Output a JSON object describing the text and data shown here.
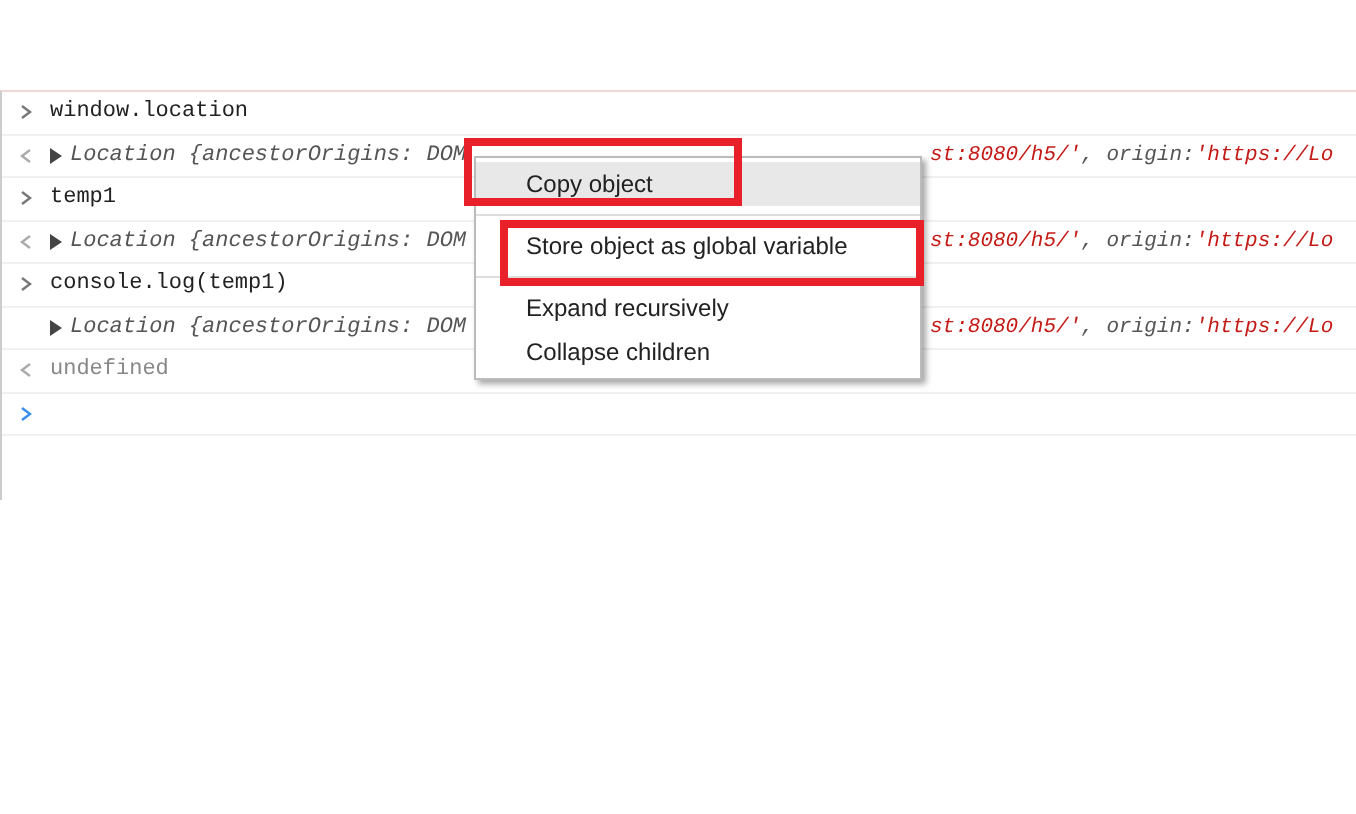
{
  "console": {
    "rows": [
      {
        "kind": "input",
        "text": "window.location"
      },
      {
        "kind": "result",
        "left": "Location {ancestorOrigins: DOM",
        "right": [
          {
            "kind": "string",
            "text": "st:8080/h5/'"
          },
          {
            "kind": "key",
            "text": ", origin: "
          },
          {
            "kind": "string",
            "text": "'https://Lo"
          }
        ]
      },
      {
        "kind": "input",
        "text": "temp1"
      },
      {
        "kind": "result",
        "left": "Location {ancestorOrigins: DOM",
        "right": [
          {
            "kind": "string",
            "text": "st:8080/h5/'"
          },
          {
            "kind": "key",
            "text": ", origin: "
          },
          {
            "kind": "string",
            "text": "'https://Lo"
          }
        ]
      },
      {
        "kind": "input",
        "text": "console.log(temp1)"
      },
      {
        "kind": "log",
        "left": "Location {ancestorOrigins: DOM",
        "right": [
          {
            "kind": "string",
            "text": "st:8080/h5/'"
          },
          {
            "kind": "key",
            "text": ", origin: "
          },
          {
            "kind": "string",
            "text": "'https://Lo"
          }
        ]
      },
      {
        "kind": "return",
        "text": "undefined"
      },
      {
        "kind": "prompt"
      }
    ]
  },
  "context_menu": {
    "groups": [
      [
        {
          "label": "Copy object",
          "selected": true,
          "annotated": true
        }
      ],
      [
        {
          "label": "Store object as global variable",
          "selected": false,
          "annotated": true
        }
      ],
      [
        {
          "label": "Expand recursively",
          "selected": false,
          "annotated": false
        },
        {
          "label": "Collapse children",
          "selected": false,
          "annotated": false
        }
      ]
    ]
  }
}
